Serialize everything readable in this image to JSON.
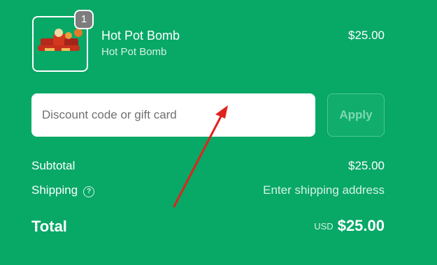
{
  "line_item": {
    "quantity": "1",
    "name": "Hot Pot Bomb",
    "variant": "Hot Pot Bomb",
    "price": "$25.00",
    "thumbnail_icon": "product-photo-icon"
  },
  "discount": {
    "placeholder": "Discount code or gift card",
    "value": "",
    "apply_label": "Apply"
  },
  "summary": {
    "subtotal_label": "Subtotal",
    "subtotal_value": "$25.00",
    "shipping_label": "Shipping",
    "shipping_help_icon": "question-circle-icon",
    "shipping_value": "Enter shipping address",
    "total_label": "Total",
    "currency": "USD",
    "total_value": "$25.00"
  },
  "colors": {
    "background": "#08a867",
    "annotation": "#e0231c",
    "badge": "#7d7d7d"
  }
}
